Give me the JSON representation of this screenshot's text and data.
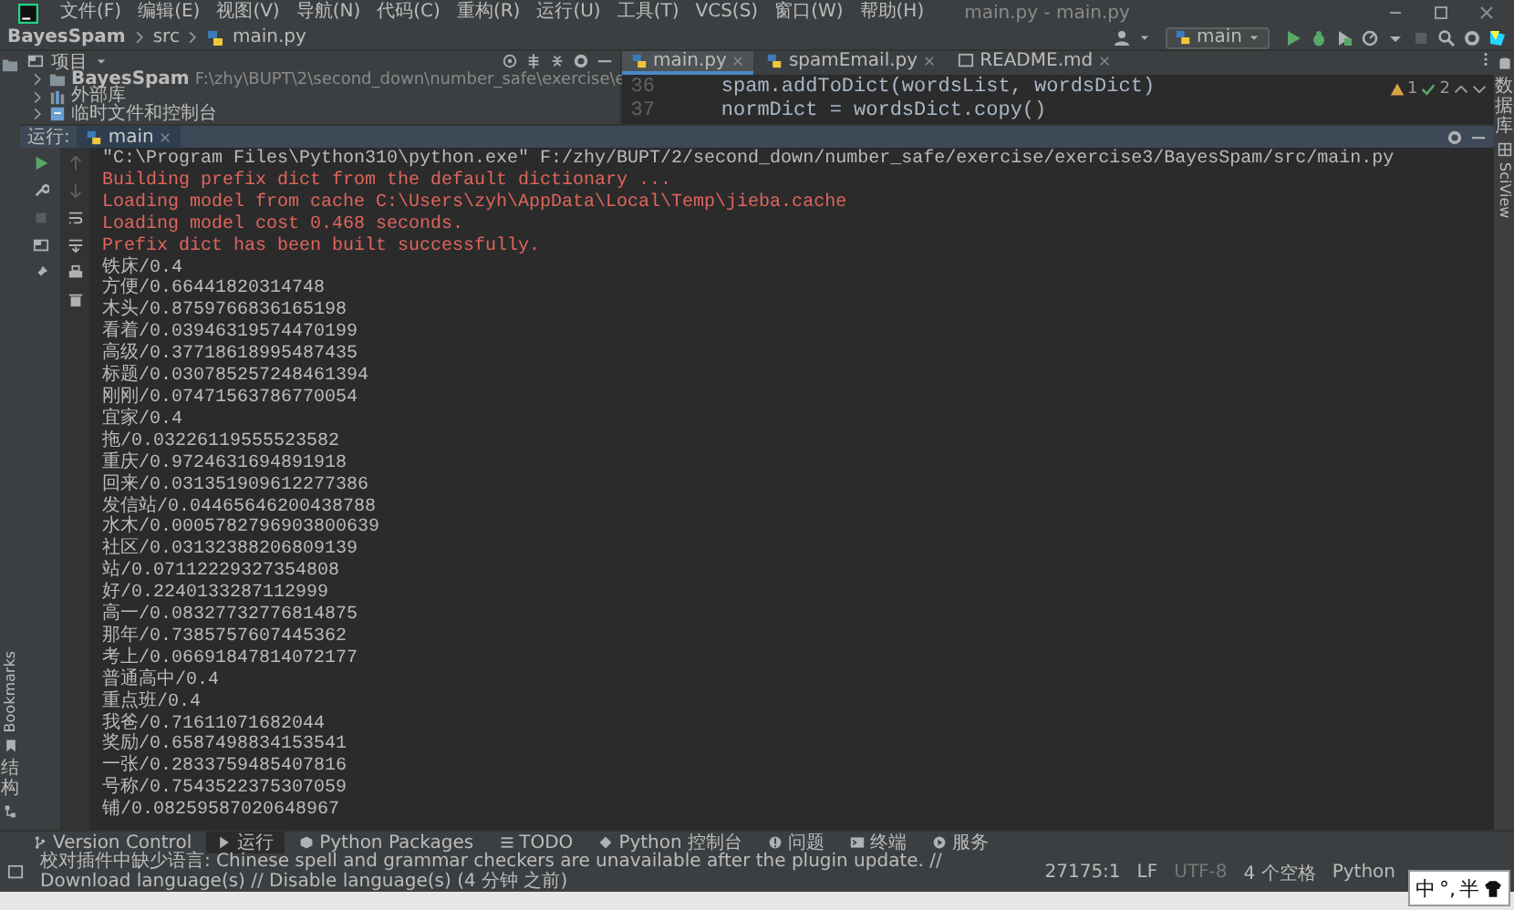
{
  "title_bar": {
    "menu": [
      "文件(F)",
      "编辑(E)",
      "视图(V)",
      "导航(N)",
      "代码(C)",
      "重构(R)",
      "运行(U)",
      "工具(T)",
      "VCS(S)",
      "窗口(W)",
      "帮助(H)"
    ],
    "title": "main.py - main.py"
  },
  "nav_bar": {
    "breadcrumb": [
      "BayesSpam",
      "src",
      "main.py"
    ],
    "run_config": "main"
  },
  "project_panel": {
    "title": "项目",
    "items": [
      {
        "label": "BayesSpam",
        "path": "F:\\zhy\\BUPT\\2\\second_down\\number_safe\\exercise\\e",
        "expanded": false
      },
      {
        "label": "外部库",
        "expanded": false
      },
      {
        "label": "临时文件和控制台",
        "expanded": false
      }
    ]
  },
  "editor": {
    "tabs": [
      {
        "label": "main.py",
        "selected": true
      },
      {
        "label": "spamEmail.py",
        "selected": false
      },
      {
        "label": "README.md",
        "selected": false
      }
    ],
    "lines": [
      {
        "number": "36",
        "code": "    spam.addToDict(wordsList, wordsDict)"
      },
      {
        "number": "37",
        "code": "    normDict = wordsDict.copy()"
      }
    ],
    "warnings": "1",
    "checks": "2"
  },
  "side_tabs": {
    "left": [
      {
        "label": "Bookmarks",
        "kind": "rotated"
      },
      {
        "label": "结构",
        "kind": "stacked"
      }
    ],
    "right": [
      {
        "label": "数据库",
        "kind": "stacked"
      },
      {
        "label": "SciView",
        "kind": "rotated"
      }
    ]
  },
  "run_panel": {
    "label": "运行:",
    "tab": "main",
    "output": [
      {
        "kind": "command",
        "text": "\"C:\\Program Files\\Python310\\python.exe\" F:/zhy/BUPT/2/second_down/number_safe/exercise/exercise3/BayesSpam/src/main.py"
      },
      {
        "kind": "error",
        "text": "Building prefix dict from the default dictionary ..."
      },
      {
        "kind": "error",
        "text": "Loading model from cache C:\\Users\\zyh\\AppData\\Local\\Temp\\jieba.cache"
      },
      {
        "kind": "error",
        "text": "Loading model cost 0.468 seconds."
      },
      {
        "kind": "error",
        "text": "Prefix dict has been built successfully."
      },
      {
        "kind": "plain",
        "text": "铁床/0.4"
      },
      {
        "kind": "plain",
        "text": "方便/0.66441820314748"
      },
      {
        "kind": "plain",
        "text": "木头/0.8759766836165198"
      },
      {
        "kind": "plain",
        "text": "看着/0.03946319574470199"
      },
      {
        "kind": "plain",
        "text": "高级/0.37718618995487435"
      },
      {
        "kind": "plain",
        "text": "标题/0.030785257248461394"
      },
      {
        "kind": "plain",
        "text": "刚刚/0.07471563786770054"
      },
      {
        "kind": "plain",
        "text": "宜家/0.4"
      },
      {
        "kind": "plain",
        "text": "拖/0.03226119555523582"
      },
      {
        "kind": "plain",
        "text": "重庆/0.9724631694891918"
      },
      {
        "kind": "plain",
        "text": "回来/0.031351909612277386"
      },
      {
        "kind": "plain",
        "text": "发信站/0.04465646200438788"
      },
      {
        "kind": "plain",
        "text": "水木/0.0005782796903800639"
      },
      {
        "kind": "plain",
        "text": "社区/0.03132388206809139"
      },
      {
        "kind": "plain",
        "text": "站/0.07112229327354808"
      },
      {
        "kind": "plain",
        "text": "好/0.2240133287112999"
      },
      {
        "kind": "plain",
        "text": "高一/0.08327732776814875"
      },
      {
        "kind": "plain",
        "text": "那年/0.7385757607445362"
      },
      {
        "kind": "plain",
        "text": "考上/0.06691847814072177"
      },
      {
        "kind": "plain",
        "text": "普通高中/0.4"
      },
      {
        "kind": "plain",
        "text": "重点班/0.4"
      },
      {
        "kind": "plain",
        "text": "我爸/0.71611071682044"
      },
      {
        "kind": "plain",
        "text": "奖励/0.6587498834153541"
      },
      {
        "kind": "plain",
        "text": "一张/0.2833759485407816"
      },
      {
        "kind": "plain",
        "text": "号称/0.7543522375307059"
      },
      {
        "kind": "plain",
        "text": "铺/0.08259587020648967"
      }
    ]
  },
  "tool_tabs": [
    {
      "label": "Version Control",
      "selected": false
    },
    {
      "label": "运行",
      "selected": true
    },
    {
      "label": "Python Packages",
      "selected": false
    },
    {
      "label": "TODO",
      "selected": false
    },
    {
      "label": "Python 控制台",
      "selected": false
    },
    {
      "label": "问题",
      "selected": false
    },
    {
      "label": "终端",
      "selected": false
    },
    {
      "label": "服务",
      "selected": false
    }
  ],
  "status_bar": {
    "message": "校对插件中缺少语言: Chinese spell and grammar checkers are unavailable after the plugin update. // Download language(s) // Disable language(s) (4 分钟 之前)",
    "position": "27175:1",
    "line_ending": "LF",
    "encoding": "UTF-8",
    "indent": "4 个空格",
    "interpreter": "Python"
  },
  "ime": {
    "mode": "中",
    "punctuation": "°,",
    "width": "半"
  }
}
